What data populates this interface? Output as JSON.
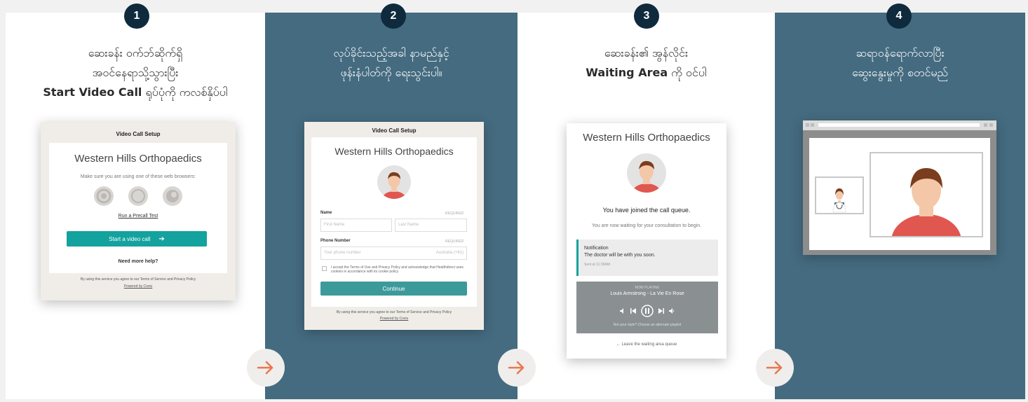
{
  "steps": [
    {
      "number": "1",
      "line1": "ဆေးခန်း ဝက်ဘ်ဆိုက်ရှိ",
      "line2": "အဝင်နေရာသို့သွားပြီး",
      "line3_bold": "Start Video Call",
      "line3_rest": " ရုပ်ပုံကို ကလစ်နှိပ်ပါ"
    },
    {
      "number": "2",
      "line1": "လုပ်ခိုင်းသည့်အခါ နာမည်နှင့်",
      "line2": "ဖုန်းနံပါတ်ကို ရေးသွင်းပါ။"
    },
    {
      "number": "3",
      "line1": "ဆေးခန်း၏ အွန်လိုင်း",
      "line2_bold": "Waiting Area",
      "line2_rest": " ကို ဝင်ပါ"
    },
    {
      "number": "4",
      "line1": "ဆရာဝန်ရောက်လာပြီး",
      "line2": "ဆွေးနွေးမှုကို စတင်မည်"
    }
  ],
  "mock1": {
    "header": "Video Call Setup",
    "clinic": "Western Hills Orthopaedics",
    "browsers_note": "Make sure you are using one of these web browsers:",
    "precall_link": "Run a Precall Test",
    "start_button": "Start a video call",
    "help": "Need more help?",
    "footer1": "By using this service you agree to our Terms of Service and Privacy Policy",
    "footer2": "Powered by Coviu"
  },
  "mock2": {
    "header": "Video Call Setup",
    "clinic": "Western Hills Orthopaedics",
    "name_label": "Name",
    "required": "REQUIRED",
    "first_name": "First Name",
    "last_name": "Last Name",
    "phone_label": "Phone Number",
    "phone_placeholder": "Your phone number",
    "country": "Australia (+61)",
    "consent": "I accept the Terms of Use and Privacy Policy and acknowledge that Healthdirect uses cookies in accordance with its cookie policy",
    "continue": "Continue",
    "footer1": "By using this service you agree to our Terms of Service and Privacy Policy",
    "footer2": "Powered by Coviu"
  },
  "mock3": {
    "clinic": "Western Hills Orthopaedics",
    "joined": "You have joined the call queue.",
    "waiting": "You are now waiting for your consultation to begin.",
    "notif_title": "Notification",
    "notif_text": "The doctor will be with you soon.",
    "notif_time": "Sent at 11:30AM",
    "now_playing": "NOW PLAYING",
    "track": "Louis Armstrong - La Vie En Rose",
    "style_note": "Not your style? Choose an alternate playlist",
    "leave": "Leave the waiting area queue"
  },
  "colors": {
    "panel_blue": "#456b80",
    "badge_navy": "#0f2a3d",
    "teal": "#14a29e",
    "arrow_orange": "#e9774f"
  }
}
